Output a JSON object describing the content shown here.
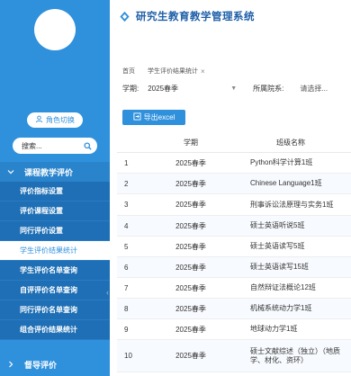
{
  "app": {
    "title": "研究生教育教学管理系统"
  },
  "sidebar": {
    "user_lines": [
      "",
      "",
      ""
    ],
    "role_button": "角色切换",
    "search_placeholder": "搜索...",
    "group1_label": "课程教学评价",
    "group2_label": "督导评价",
    "items": [
      {
        "label": "评价指标设置",
        "active": false
      },
      {
        "label": "评价课程设置",
        "active": false
      },
      {
        "label": "同行评价设置",
        "active": false
      },
      {
        "label": "学生评价结果统计",
        "active": true
      },
      {
        "label": "学生评价名单查询",
        "active": false
      },
      {
        "label": "自评评价名单查询",
        "active": false
      },
      {
        "label": "同行评价名单查询",
        "active": false
      },
      {
        "label": "组合评价结果统计",
        "active": false
      }
    ]
  },
  "tabs": [
    {
      "label": "首页",
      "closable": false
    },
    {
      "label": "学生评价结果统计",
      "closable": true
    }
  ],
  "filters": {
    "term_label": "学期:",
    "term_value": "2025春季",
    "dept_label": "所属院系:",
    "dept_placeholder": "请选择..."
  },
  "export_button": "导出excel",
  "table": {
    "headers": [
      "",
      "学期",
      "班级名称"
    ],
    "rows": [
      {
        "idx": "1",
        "term": "2025春季",
        "class": "Python科学计算1班"
      },
      {
        "idx": "2",
        "term": "2025春季",
        "class": "Chinese Language1班"
      },
      {
        "idx": "3",
        "term": "2025春季",
        "class": "刑事诉讼法原理与实务1班"
      },
      {
        "idx": "4",
        "term": "2025春季",
        "class": "硕士英语听说5班"
      },
      {
        "idx": "5",
        "term": "2025春季",
        "class": "硕士英语读写5班"
      },
      {
        "idx": "6",
        "term": "2025春季",
        "class": "硕士英语读写15班"
      },
      {
        "idx": "7",
        "term": "2025春季",
        "class": "自然辩证法概论12班"
      },
      {
        "idx": "8",
        "term": "2025春季",
        "class": "机械系统动力学1班"
      },
      {
        "idx": "9",
        "term": "2025春季",
        "class": "地球动力学1班"
      },
      {
        "idx": "10",
        "term": "2025春季",
        "class": "硕士文献综述（独立）（地质学、材化、资环）"
      }
    ]
  },
  "colors": {
    "sidebar": "#2f90dc",
    "accent": "#2f90dc",
    "title": "#1e5fa8"
  }
}
